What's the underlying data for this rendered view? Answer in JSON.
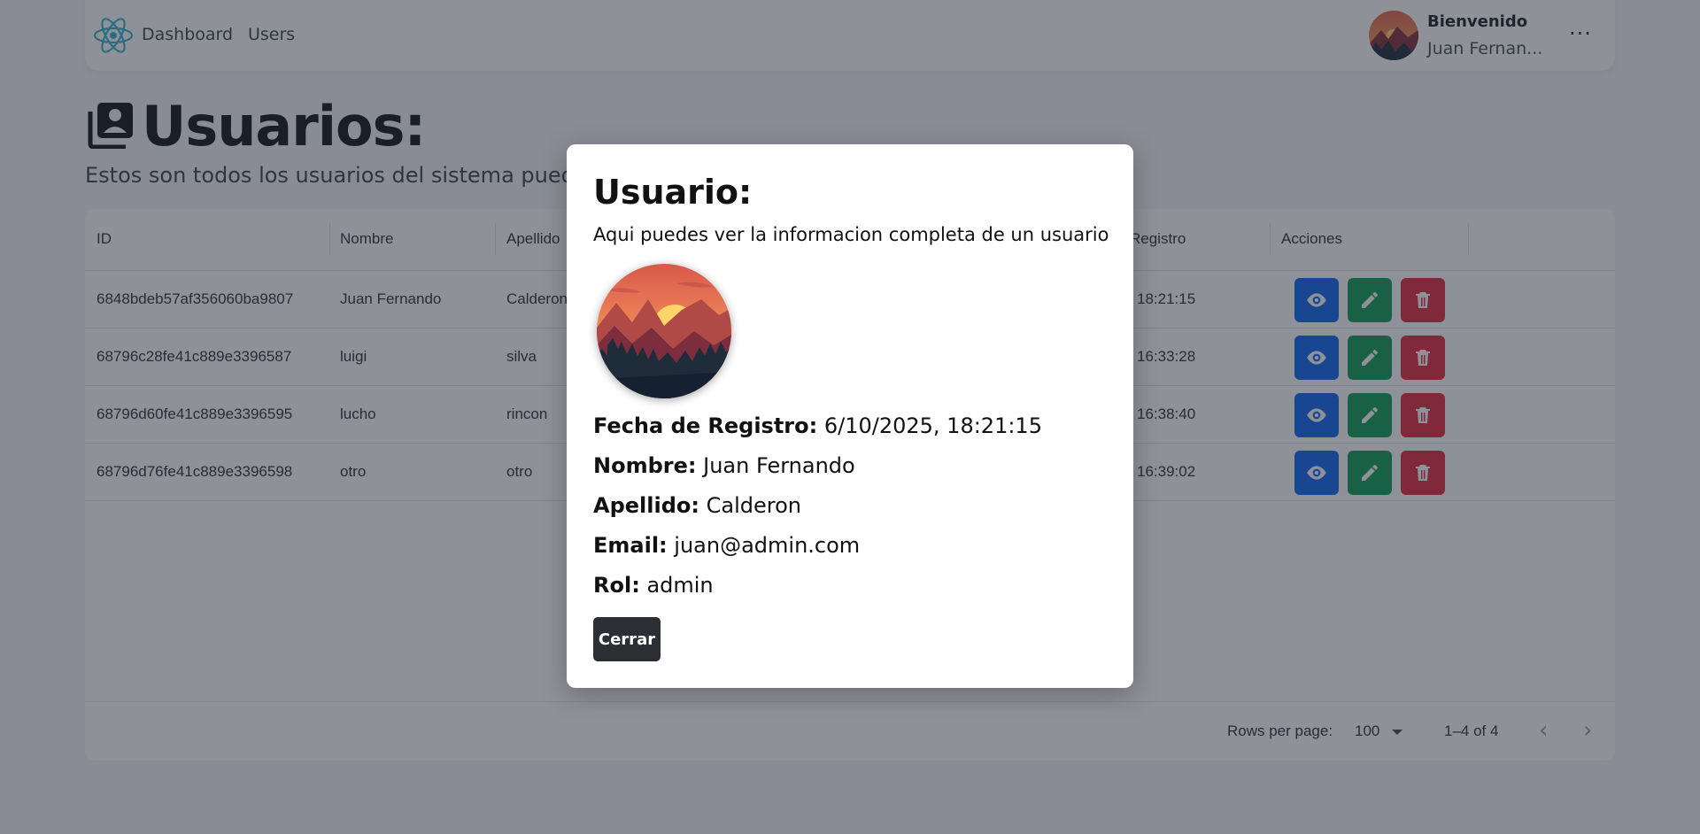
{
  "nav": {
    "logo_icon": "react-atom-icon",
    "links": [
      "Dashboard",
      "Users"
    ],
    "welcome": "Bienvenido",
    "user_name": "Juan Fernan...",
    "more": "···"
  },
  "page": {
    "title_icon": "user-list-icon",
    "title": "Usuarios:",
    "subtitle": "Estos son todos los usuarios del sistema puedes e"
  },
  "table": {
    "headers": [
      "ID",
      "Nombre",
      "Apellido",
      "Registro",
      "Acciones"
    ],
    "rows": [
      {
        "id": "6848bdeb57af356060ba9807",
        "nombre": "Juan Fernando",
        "apellido": "Calderon",
        "registro": "18:21:15"
      },
      {
        "id": "68796c28fe41c889e3396587",
        "nombre": "luigi",
        "apellido": "silva",
        "registro": "16:33:28"
      },
      {
        "id": "68796d60fe41c889e3396595",
        "nombre": "lucho",
        "apellido": "rincon",
        "registro": "16:38:40"
      },
      {
        "id": "68796d76fe41c889e3396598",
        "nombre": "otro",
        "apellido": "otro",
        "registro": "16:39:02"
      }
    ],
    "action_icons": [
      "eye-icon",
      "pencil-icon",
      "trash-icon"
    ],
    "colors": {
      "view": "#1e6ff0",
      "edit": "#1ea463",
      "delete": "#e3394b"
    },
    "pagination": {
      "rows_per_page_label": "Rows per page:",
      "rows_per_page_value": "100",
      "range": "1–4 of 4",
      "prev": "‹",
      "next": "›"
    }
  },
  "modal": {
    "title": "Usuario:",
    "subtitle": "Aqui puedes ver la informacion completa de un usuario",
    "fields": [
      {
        "label": "Fecha de Registro:",
        "value": "6/10/2025, 18:21:15"
      },
      {
        "label": "Nombre:",
        "value": "Juan Fernando"
      },
      {
        "label": "Apellido:",
        "value": "Calderon"
      },
      {
        "label": "Email:",
        "value": "juan@admin.com"
      },
      {
        "label": "Rol:",
        "value": "admin"
      }
    ],
    "close_label": "Cerrar"
  }
}
